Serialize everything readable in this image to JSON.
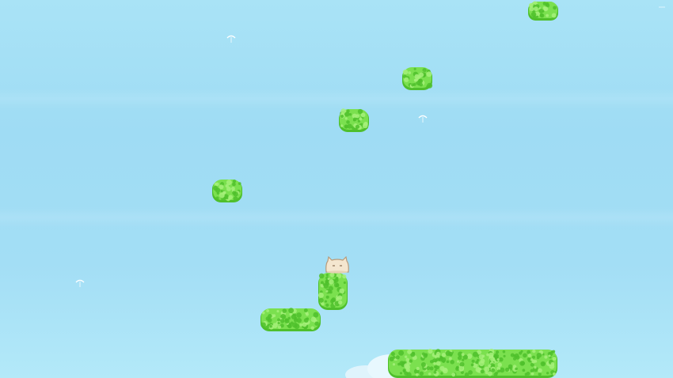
{
  "scene": {
    "sky_color_top": "#a9e3f6",
    "sky_color_bottom": "#b3e9f9",
    "bush_color": "#7be04f",
    "bush_shadow": "#4fbf2c",
    "bush_highlight": "#a6f07a",
    "player": {
      "type": "cat-blob",
      "color": "#f4e6cf",
      "outline": "#b89b7a"
    }
  },
  "icons": {
    "seed": "dandelion-seed-icon",
    "player": "cat-blob-icon",
    "platform": "leafy-bush-icon",
    "cloud": "cloud-icon"
  }
}
